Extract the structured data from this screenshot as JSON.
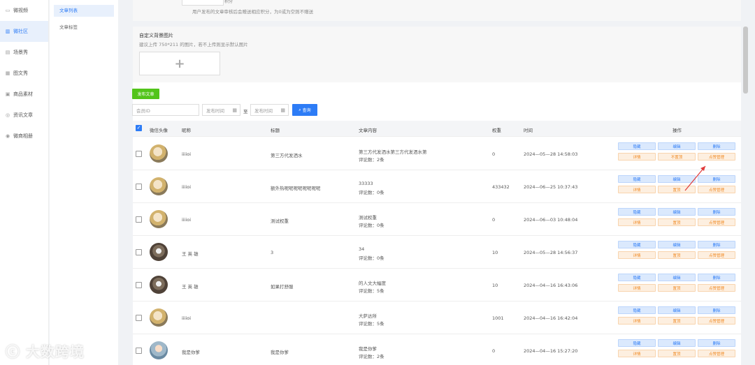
{
  "sidebar": {
    "items": [
      {
        "label": "微视频",
        "icon": "video-icon",
        "active": false
      },
      {
        "label": "微社区",
        "icon": "community-icon",
        "active": true
      },
      {
        "label": "场景秀",
        "icon": "scene-icon",
        "active": false
      },
      {
        "label": "图文秀",
        "icon": "image-text-icon",
        "active": false
      },
      {
        "label": "商品素材",
        "icon": "goods-icon",
        "active": false
      },
      {
        "label": "资讯文章",
        "icon": "article-icon",
        "active": false
      },
      {
        "label": "微商相册",
        "icon": "album-icon",
        "active": false
      }
    ]
  },
  "submenu": {
    "items": [
      {
        "label": "文章列表",
        "active": true
      },
      {
        "label": "文章标签",
        "active": false
      }
    ]
  },
  "form": {
    "points_unit": "积分",
    "points_hint": "用户发布的文章审核后会赠送相应积分，为0或为空则不赠送",
    "bg_title": "自定义背景图片",
    "bg_hint": "建议上传 750*211 的图片，若不上传则显示默认图片",
    "upload_symbol": "+"
  },
  "toolbar": {
    "publish_label": "发布文章",
    "member_placeholder": "会员ID",
    "start_placeholder": "发布时间",
    "to_label": "至",
    "end_placeholder": "发布时间",
    "query_label": "查询"
  },
  "table": {
    "headers": {
      "avatar": "微信头像",
      "nickname": "昵称",
      "title": "标题",
      "content": "文章内容",
      "weight": "权重",
      "time": "时间",
      "ops": "操作"
    },
    "rows": [
      {
        "avatar": "avatar-icon",
        "nickname": "iiiioi",
        "title": "第三方代发洒水",
        "content": "第三方代发洒水第三方代发洒水第",
        "comments": "评论数：2条",
        "weight": "0",
        "time": "2024—05—28 14:58:03",
        "ops": [
          "隐藏",
          "编辑",
          "删除",
          "详情",
          "不置顶",
          "点赞管理"
        ]
      },
      {
        "avatar": "avatar-icon",
        "nickname": "iiiioi",
        "title": "额外热呢呢呢呢呢呢呢呢",
        "content": "33333",
        "comments": "评论数：0条",
        "weight": "433432",
        "time": "2024—06—25 10:37:43",
        "ops": [
          "隐藏",
          "编辑",
          "删除",
          "详情",
          "置顶",
          "点赞管理"
        ]
      },
      {
        "avatar": "avatar-icon",
        "nickname": "iiiioi",
        "title": "测试权重",
        "content": "测试权重",
        "comments": "评论数：0条",
        "weight": "0",
        "time": "2024—06—03 10:48:04",
        "ops": [
          "隐藏",
          "编辑",
          "删除",
          "详情",
          "置顶",
          "点赞管理"
        ]
      },
      {
        "avatar": "avatar-dog-icon",
        "nickname": "王 英 雄",
        "title": "3",
        "content": "34",
        "comments": "评论数：0条",
        "weight": "10",
        "time": "2024—05—28 14:56:37",
        "ops": [
          "隐藏",
          "编辑",
          "删除",
          "详情",
          "置顶",
          "点赞管理"
        ]
      },
      {
        "avatar": "avatar-dog-icon",
        "nickname": "王 英 雄",
        "title": "如果打舒服",
        "content": "的人文大幅度",
        "comments": "评论数：5条",
        "weight": "10",
        "time": "2024—04—16 16:43:06",
        "ops": [
          "隐藏",
          "编辑",
          "删除",
          "详情",
          "置顶",
          "点赞管理"
        ]
      },
      {
        "avatar": "avatar-icon",
        "nickname": "iiiioi",
        "title": "",
        "content": "大萨达所",
        "comments": "评论数：5条",
        "weight": "1001",
        "time": "2024—04—16 16:42:04",
        "ops": [
          "隐藏",
          "编辑",
          "删除",
          "详情",
          "置顶",
          "点赞管理"
        ]
      },
      {
        "avatar": "avatar-kid-icon",
        "nickname": "我是你爹",
        "title": "我是你爹",
        "content": "我是你爹",
        "comments": "评论数：2条",
        "weight": "0",
        "time": "2024—04—16 15:27:20",
        "ops": [
          "隐藏",
          "编辑",
          "删除",
          "详情",
          "置顶",
          "点赞管理"
        ]
      }
    ]
  },
  "watermark": "大数跨境",
  "colors": {
    "primary": "#2d7cf6",
    "success": "#52c41a",
    "warning": "#f08a24",
    "annotation": "#e03a3a"
  }
}
